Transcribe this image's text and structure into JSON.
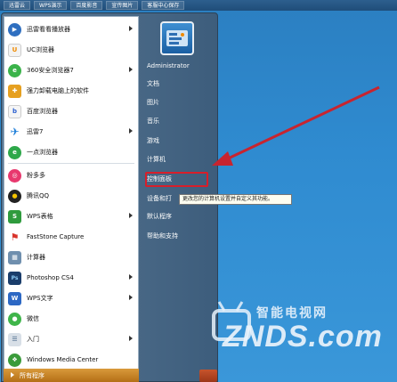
{
  "topbar": [
    "迅雷云",
    "WPS演示",
    "百度影音",
    "宣传图片",
    "客服中心保存"
  ],
  "programs": [
    {
      "label": "迅雷看看播放器",
      "icon": "xunlei-kankan-icon",
      "arrow": true
    },
    {
      "label": "UC浏览器",
      "icon": "uc-browser-icon",
      "arrow": false
    },
    {
      "label": "360安全浏览器7",
      "icon": "360-browser-icon",
      "arrow": true
    },
    {
      "label": "强力卸载电脑上的软件",
      "icon": "uninstall-icon",
      "arrow": false
    },
    {
      "label": "百度浏览器",
      "icon": "baidu-browser-icon",
      "arrow": false
    },
    {
      "label": "迅雷7",
      "icon": "xunlei-icon",
      "arrow": true
    },
    {
      "label": "一点浏览器",
      "icon": "yidian-browser-icon",
      "arrow": false
    },
    {
      "label": "粉多多",
      "icon": "fenduoduo-icon",
      "arrow": false
    },
    {
      "label": "腾讯QQ",
      "icon": "qq-icon",
      "arrow": false
    },
    {
      "label": "WPS表格",
      "icon": "wps-sheet-icon",
      "arrow": true
    },
    {
      "label": "FastStone Capture",
      "icon": "faststone-icon",
      "arrow": false
    },
    {
      "label": "计算器",
      "icon": "calculator-icon",
      "arrow": false
    },
    {
      "label": "Photoshop CS4",
      "icon": "photoshop-icon",
      "arrow": true
    },
    {
      "label": "WPS文字",
      "icon": "wps-writer-icon",
      "arrow": true
    },
    {
      "label": "微信",
      "icon": "wechat-icon",
      "arrow": false
    },
    {
      "label": "入门",
      "icon": "getting-started-icon",
      "arrow": true
    },
    {
      "label": "Windows Media Center",
      "icon": "media-center-icon",
      "arrow": false
    }
  ],
  "all_programs": "所有程序",
  "right_pane": {
    "user": "Administrator",
    "items": [
      "文档",
      "图片",
      "音乐",
      "游戏",
      "计算机",
      "控制面板",
      "设备和打",
      "默认程序",
      "帮助和支持"
    ]
  },
  "tooltip": "更改您的计算机设置并自定义其功能。",
  "watermark": {
    "top": "智能电视网",
    "bottom": "ZNDS.com"
  },
  "colors": {
    "highlight_box": "#d81e2a",
    "arrow": "#c8242f",
    "all_programs_bg": "#c27d22"
  }
}
